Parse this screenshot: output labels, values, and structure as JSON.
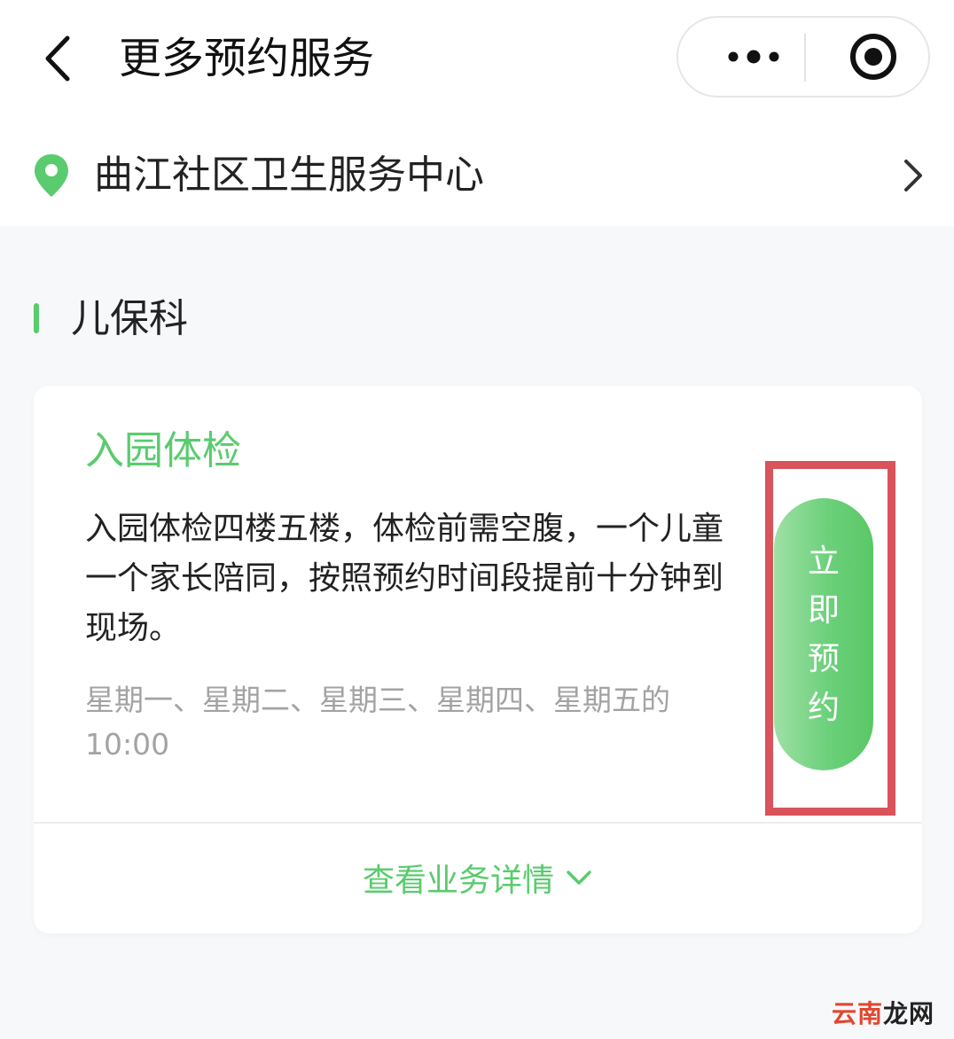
{
  "nav": {
    "title": "更多预约服务",
    "icons": [
      "chevron-left-icon",
      "more-dots-icon",
      "record-icon"
    ]
  },
  "location": {
    "name": "曲江社区卫生服务中心",
    "icon": "location-pin-icon"
  },
  "section": {
    "label": "儿保科"
  },
  "service": {
    "title": "入园体检",
    "description": "入园体检四楼五楼，体检前需空腹，一个儿童一个家长陪同，按照预约时间段提前十分钟到现场。",
    "schedule": "星期一、星期二、星期三、星期四、星期五的 10:00",
    "book_label": "立即预约",
    "details_label": "查看业务详情"
  },
  "watermark": {
    "part1": "云南",
    "part2": "龙网"
  },
  "colors": {
    "accent": "#5acb6e",
    "highlight_box": "#d9535a",
    "background": "#f7f8fa",
    "muted_text": "#a3a3a3"
  }
}
